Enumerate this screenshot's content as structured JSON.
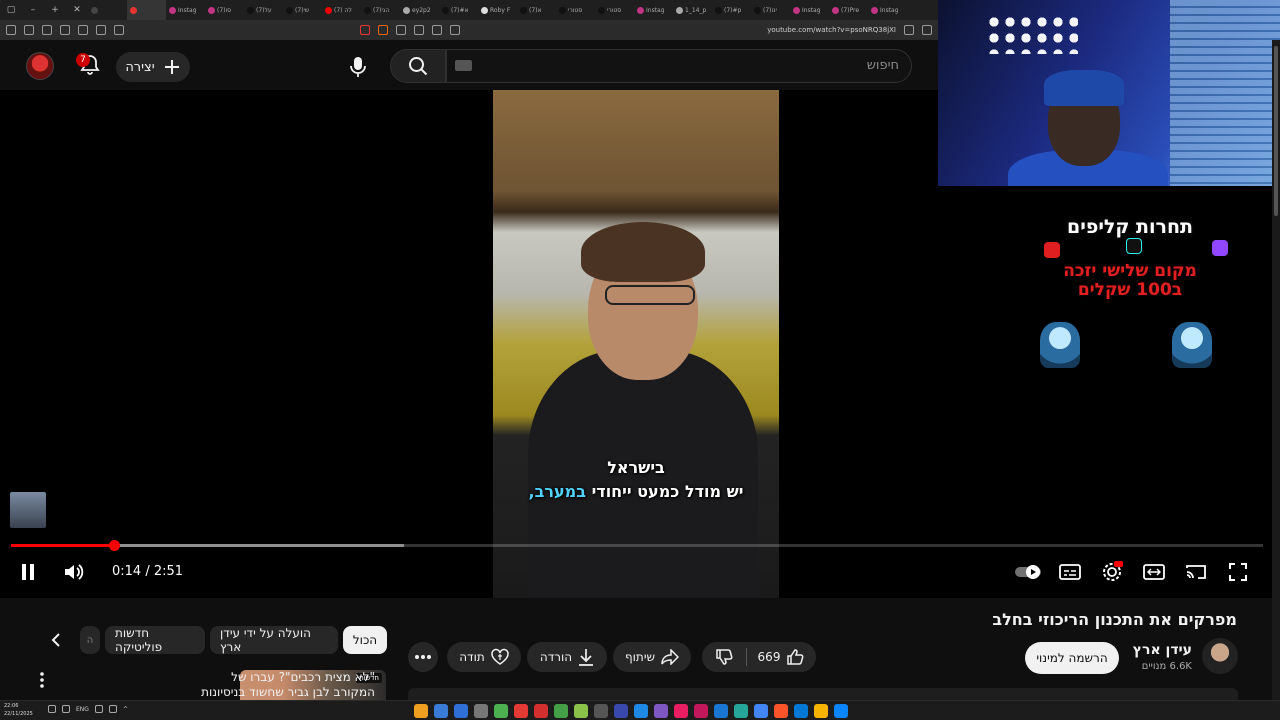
{
  "browser": {
    "tabs": [
      {
        "label": "",
        "color": "#444"
      },
      {
        "label": "",
        "color": "#e33"
      },
      {
        "label": "Instag",
        "color": "#c13584"
      },
      {
        "label": "(7)סו",
        "color": "#c13584"
      },
      {
        "label": "(7)על",
        "color": "#111"
      },
      {
        "label": "(7)שי",
        "color": "#111"
      },
      {
        "label": "(7) לה",
        "color": "#e00"
      },
      {
        "label": "(7)הגי",
        "color": "#111"
      },
      {
        "label": "ey2p2",
        "color": "#aaa"
      },
      {
        "label": "(7)#א",
        "color": "#111"
      },
      {
        "label": "Roby F",
        "color": "#ddd"
      },
      {
        "label": "(7)א",
        "color": "#111"
      },
      {
        "label": "סטורי",
        "color": "#111"
      },
      {
        "label": "סטורי",
        "color": "#111"
      },
      {
        "label": "Instag",
        "color": "#c13584"
      },
      {
        "label": "1_14_p",
        "color": "#aaa"
      },
      {
        "label": "(7)#p",
        "color": "#111"
      },
      {
        "label": "(7)ינו",
        "color": "#111"
      },
      {
        "label": "Instag",
        "color": "#c13584"
      },
      {
        "label": "(7)Pre",
        "color": "#c13584"
      },
      {
        "label": "Instag",
        "color": "#c13584"
      }
    ],
    "url": "youtube.com/watch?v=psoNRQ38jXI"
  },
  "header": {
    "notification_count": "7",
    "create_label": "יצירה",
    "search_placeholder": "חיפוש"
  },
  "video": {
    "subtitle_line1": "בישראל",
    "subtitle_line2_prefix": "יש מודל כמעט ייחודי ",
    "subtitle_line2_highlight": "במערב,",
    "time": "0:14 / 2:51",
    "progress_fraction": 0.082,
    "buffered_fraction": 0.314
  },
  "overlay": {
    "promo_title": "תחרות קליפים",
    "promo_sub_line1": "מקום שלישי יזכה",
    "promo_sub_line2": "ב100 שקלים"
  },
  "info": {
    "title": "מפרקים את התכנון הריכוזי בחלב",
    "channel_name": "עידן ארץ",
    "subscribers": "6.6K מנויים",
    "subscribe_label": "הרשמה למינוי",
    "likes": "669",
    "share_label": "שיתוף",
    "download_label": "הורדה",
    "thanks_label": "תודה"
  },
  "chips": {
    "all": "הכול",
    "uploaded_by": "הועלה על ידי עידן ארץ",
    "politics": "חדשות פוליטיקה",
    "partial": "ה"
  },
  "recommendation": {
    "title": "\"לא מצית רכבים\"? עברו של המקורב לבן גביר שחשוד בניסיונות של גוא של",
    "badge": "חדשות"
  },
  "taskbar": {
    "time": "22:06",
    "date": "22/11/2025",
    "lang": "ENG"
  }
}
